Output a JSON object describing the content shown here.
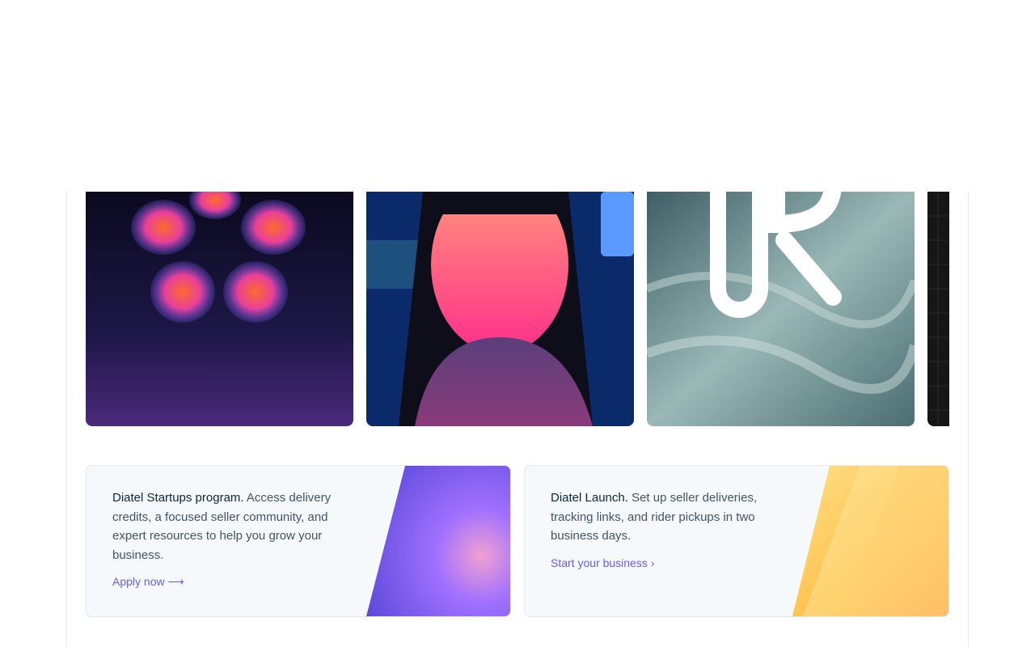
{
  "gallery": {
    "tiles": [
      {
        "icon": "hearts-flower-artwork"
      },
      {
        "icon": "woman-looking-up-illustration"
      },
      {
        "icon": "ocean-wave-logo-artwork"
      },
      {
        "icon": "dark-grid-artwork"
      }
    ]
  },
  "cards": [
    {
      "lead": "Diatel Startups program.",
      "body": " Access delivery credits, a focused seller community, and expert resources to help you grow your business.",
      "link": "Apply now ⟶",
      "accent": "#9966ff"
    },
    {
      "lead": "Diatel Launch.",
      "body": " Set up seller deliveries, tracking links, and rider pickups in two business days.",
      "link": "Start your business ›",
      "accent": "#ffb545"
    }
  ],
  "colors": {
    "link": "#635bff",
    "body_text": "#425466",
    "heading_text": "#0a2540",
    "card_bg": "#f6f9fb"
  }
}
